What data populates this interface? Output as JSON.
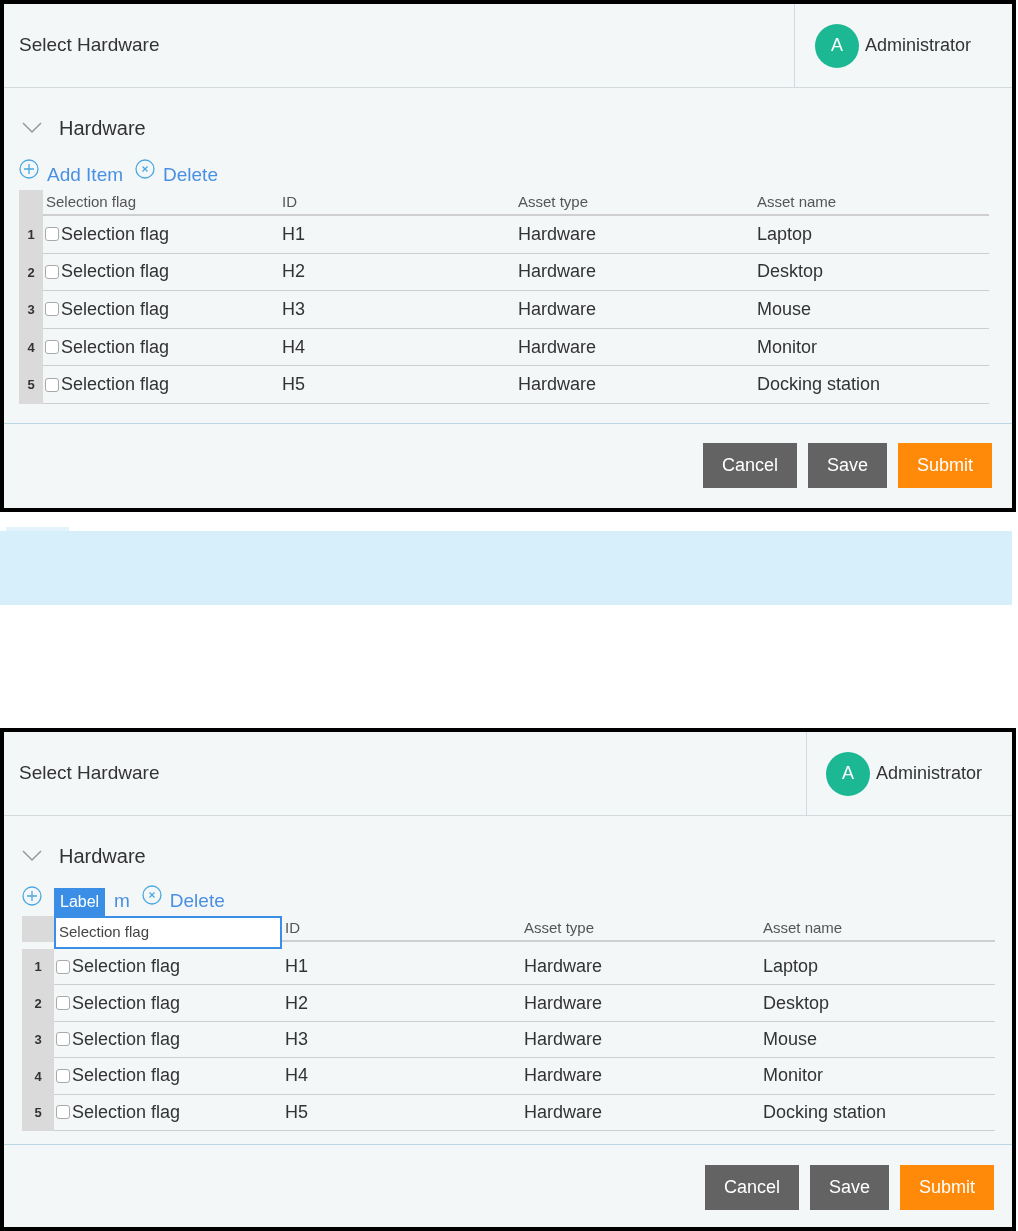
{
  "panels": [
    {
      "title": "Select Hardware",
      "user": {
        "initial": "A",
        "name": "Administrator"
      },
      "section": {
        "title": "Hardware",
        "expanded": true
      },
      "actions": [
        {
          "kind": "add",
          "label": "Add Item"
        },
        {
          "kind": "delete",
          "label": "Delete"
        }
      ],
      "columns": [
        {
          "label": "Selection flag",
          "highlighted": false
        },
        {
          "label": "ID",
          "highlighted": false
        },
        {
          "label": "Asset type",
          "highlighted": false
        },
        {
          "label": "Asset name",
          "highlighted": false
        }
      ],
      "rows": [
        {
          "number": "1",
          "checked": false,
          "flag": "Selection flag",
          "id": "H1",
          "type": "Hardware",
          "name": "Laptop"
        },
        {
          "number": "2",
          "checked": false,
          "flag": "Selection flag",
          "id": "H2",
          "type": "Hardware",
          "name": "Desktop"
        },
        {
          "number": "3",
          "checked": false,
          "flag": "Selection flag",
          "id": "H3",
          "type": "Hardware",
          "name": "Mouse"
        },
        {
          "number": "4",
          "checked": false,
          "flag": "Selection flag",
          "id": "H4",
          "type": "Hardware",
          "name": "Monitor"
        },
        {
          "number": "5",
          "checked": false,
          "flag": "Selection flag",
          "id": "H5",
          "type": "Hardware",
          "name": "Docking station"
        }
      ],
      "buttons": [
        {
          "kind": "secondary",
          "label": "Cancel"
        },
        {
          "kind": "secondary",
          "label": "Save"
        },
        {
          "kind": "primary",
          "label": "Submit"
        }
      ]
    },
    {
      "title": "Select Hardware",
      "user": {
        "initial": "A",
        "name": "Administrator"
      },
      "section": {
        "title": "Hardware",
        "expanded": true
      },
      "actions": [
        {
          "kind": "add",
          "label": "m"
        },
        {
          "kind": "delete",
          "label": "Delete"
        }
      ],
      "badge": "Label",
      "columns": [
        {
          "label": "Selection flag",
          "highlighted": true
        },
        {
          "label": "ID",
          "highlighted": false
        },
        {
          "label": "Asset type",
          "highlighted": false
        },
        {
          "label": "Asset name",
          "highlighted": false
        }
      ],
      "rows": [
        {
          "number": "1",
          "checked": false,
          "flag": "Selection flag",
          "id": "H1",
          "type": "Hardware",
          "name": "Laptop"
        },
        {
          "number": "2",
          "checked": false,
          "flag": "Selection flag",
          "id": "H2",
          "type": "Hardware",
          "name": "Desktop"
        },
        {
          "number": "3",
          "checked": false,
          "flag": "Selection flag",
          "id": "H3",
          "type": "Hardware",
          "name": "Mouse"
        },
        {
          "number": "4",
          "checked": false,
          "flag": "Selection flag",
          "id": "H4",
          "type": "Hardware",
          "name": "Monitor"
        },
        {
          "number": "5",
          "checked": false,
          "flag": "Selection flag",
          "id": "H5",
          "type": "Hardware",
          "name": "Docking station"
        }
      ],
      "buttons": [
        {
          "kind": "secondary",
          "label": "Cancel"
        },
        {
          "kind": "secondary",
          "label": "Save"
        },
        {
          "kind": "primary",
          "label": "Submit"
        }
      ]
    }
  ]
}
